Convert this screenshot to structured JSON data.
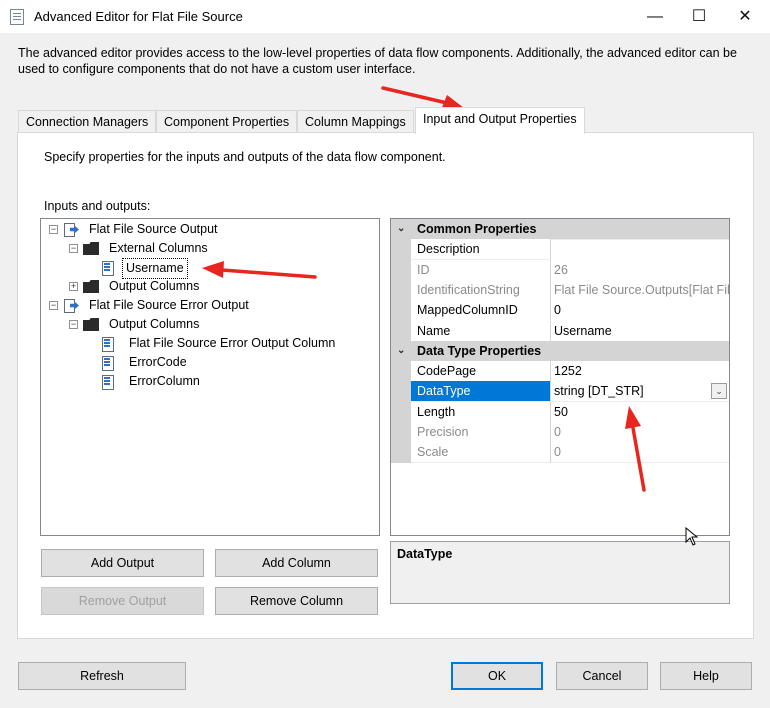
{
  "window": {
    "title": "Advanced Editor for Flat File Source",
    "minimize_glyph": "—",
    "maximize_glyph": "☐",
    "close_glyph": "✕"
  },
  "description": "The advanced editor provides access to the low-level properties of data flow components. Additionally, the advanced editor can be used to configure components that do not have a custom user interface.",
  "tabs": [
    {
      "label": "Connection Managers"
    },
    {
      "label": "Component Properties"
    },
    {
      "label": "Column Mappings"
    },
    {
      "label": "Input and Output Properties"
    }
  ],
  "panel": {
    "instruction": "Specify properties for the inputs and outputs of the data flow component.",
    "io_label": "Inputs and outputs:"
  },
  "tree": {
    "output": "Flat File Source Output",
    "external_columns": "External Columns",
    "username": "Username",
    "output_columns": "Output Columns",
    "error_output": "Flat File Source Error Output",
    "error_output_columns": "Output Columns",
    "err_col1": "Flat File Source Error Output Column",
    "err_col2": "ErrorCode",
    "err_col3": "ErrorColumn",
    "expand_glyph": "+",
    "collapse_glyph": "−"
  },
  "properties": {
    "common_category": "Common Properties",
    "datatype_category": "Data Type Properties",
    "collapse_glyph": "⌄",
    "rows": [
      {
        "name": "Description",
        "value": ""
      },
      {
        "name": "ID",
        "value": "26"
      },
      {
        "name": "IdentificationString",
        "value": "Flat File Source.Outputs[Flat File"
      },
      {
        "name": "MappedColumnID",
        "value": "0"
      },
      {
        "name": "Name",
        "value": "Username"
      },
      {
        "name": "CodePage",
        "value": "1252"
      },
      {
        "name": "DataType",
        "value": "string [DT_STR]"
      },
      {
        "name": "Length",
        "value": "50"
      },
      {
        "name": "Precision",
        "value": "0"
      },
      {
        "name": "Scale",
        "value": "0"
      }
    ],
    "dropdown_glyph": "⌄"
  },
  "help_title": "DataType",
  "buttons": {
    "add_output": "Add Output",
    "add_column": "Add Column",
    "remove_output": "Remove Output",
    "remove_column": "Remove Column",
    "refresh": "Refresh",
    "ok": "OK",
    "cancel": "Cancel",
    "help": "Help"
  },
  "colors": {
    "selection": "#0078d7",
    "annotation_arrow": "#e8251e"
  }
}
